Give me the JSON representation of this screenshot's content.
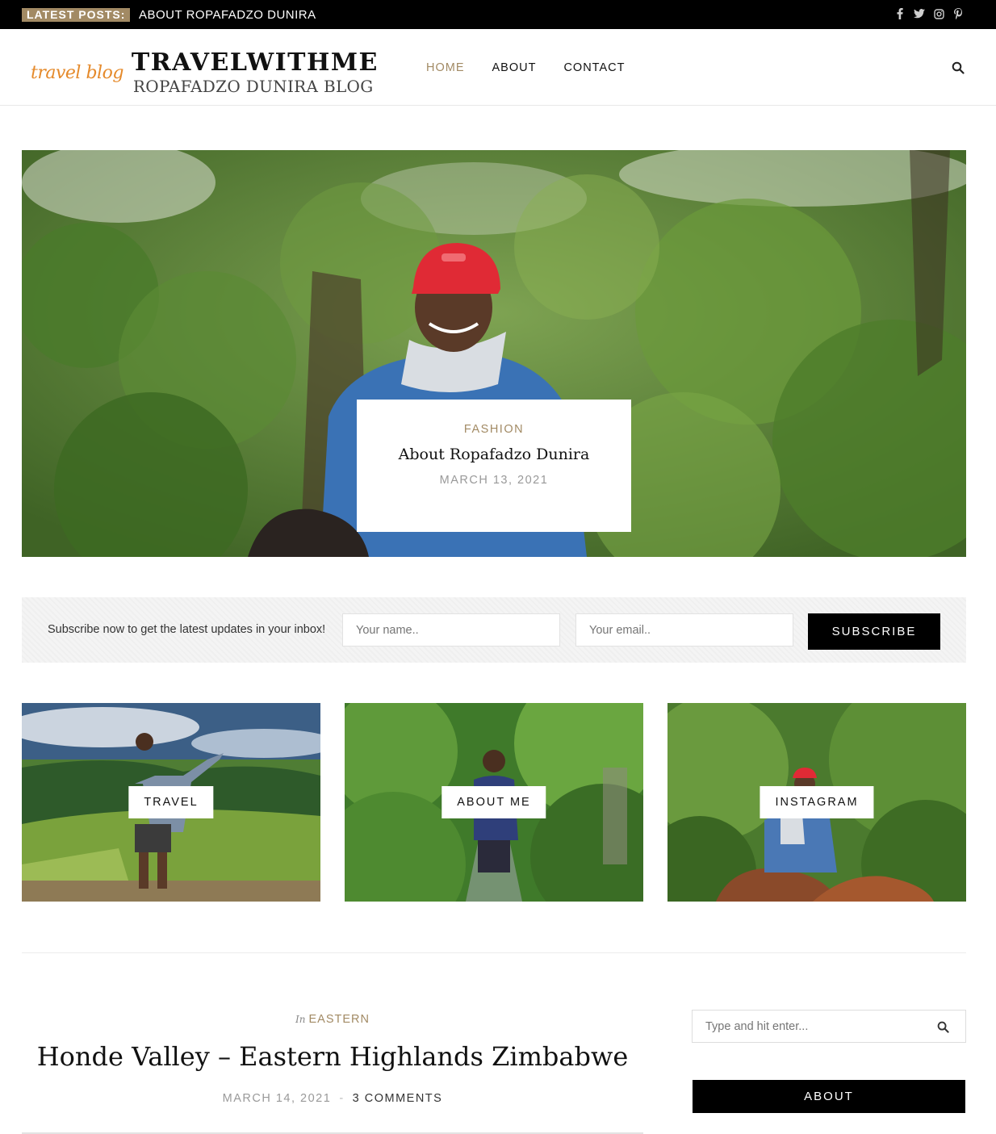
{
  "topbar": {
    "latest_label": "LATEST POSTS:",
    "latest_post": "ABOUT ROPAFADZO DUNIRA",
    "socials": [
      "facebook-icon",
      "twitter-icon",
      "instagram-icon",
      "pinterest-icon"
    ]
  },
  "header": {
    "logo_script": "travel blog",
    "logo_title": "TRAVELWITHME",
    "logo_subtitle": "ROPAFADZO DUNIRA BLOG",
    "nav": [
      {
        "label": "HOME",
        "active": true
      },
      {
        "label": "ABOUT",
        "active": false
      },
      {
        "label": "CONTACT",
        "active": false
      }
    ],
    "search_icon": "search-icon"
  },
  "hero": {
    "category": "FASHION",
    "title": "About Ropafadzo Dunira",
    "date": "MARCH 13, 2021"
  },
  "subscribe": {
    "text": "Subscribe now to get the latest updates in your inbox!",
    "name_placeholder": "Your name..",
    "email_placeholder": "Your email..",
    "button_label": "SUBSCRIBE"
  },
  "promos": [
    {
      "label": "TRAVEL"
    },
    {
      "label": "ABOUT ME"
    },
    {
      "label": "INSTAGRAM"
    }
  ],
  "post": {
    "in_label": "In",
    "category": "EASTERN",
    "title": "Honde Valley – Eastern Highlands Zimbabwe",
    "date": "MARCH 14, 2021",
    "separator": "-",
    "comments": "3 COMMENTS"
  },
  "sidebar": {
    "search_placeholder": "Type and hit enter...",
    "about_label": "ABOUT"
  },
  "colors": {
    "accent": "#a28a64",
    "logo_orange": "#e58a2b",
    "topbar": "#000000"
  }
}
